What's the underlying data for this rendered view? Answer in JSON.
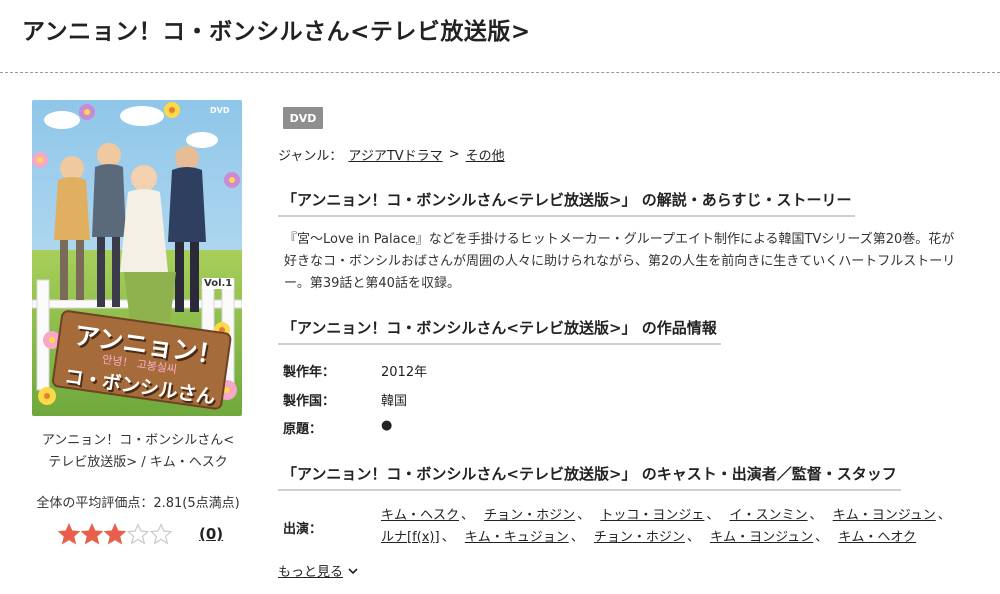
{
  "page": {
    "title": "アンニョン！コ・ボンシルさん<テレビ放送版>"
  },
  "cover": {
    "logo_line1": "アンニョン！",
    "logo_line2": "コ・ボンシルさん",
    "logo_sub": "안녕！ 고봉실씨",
    "vol": "Vol.1",
    "format_mark": "DVD"
  },
  "caption": {
    "line1": "アンニョン！コ・ボンシルさん<",
    "line2": "テレビ放送版> / キム・ヘスク"
  },
  "rating": {
    "label": "全体の平均評価点：2.81(5点満点)",
    "value": 2.81,
    "max": 5,
    "filled_stars": 3,
    "review_count": "(0)",
    "star_color": "#e8604c"
  },
  "badge": "DVD",
  "genre": {
    "label": "ジャンル：",
    "links": [
      "アジアTVドラマ",
      "その他"
    ],
    "separator": ">"
  },
  "synopsis": {
    "heading": "「アンニョン！コ・ボンシルさん<テレビ放送版>」 の解説・あらすじ・ストーリー",
    "text": "『宮〜Love in Palace』などを手掛けるヒットメーカー・グループエイト制作による韓国TVシリーズ第20巻。花が好きなコ・ボンシルおばさんが周囲の人々に助けられながら、第2の人生を前向きに生きていくハートフルストーリー。第39話と第40話を収録。"
  },
  "info": {
    "heading": "「アンニョン！コ・ボンシルさん<テレビ放送版>」 の作品情報",
    "rows": [
      {
        "label": "製作年：",
        "value": "2012年"
      },
      {
        "label": "製作国：",
        "value": "韓国"
      },
      {
        "label": "原題：",
        "value": "●"
      }
    ]
  },
  "cast": {
    "heading": "「アンニョン！コ・ボンシルさん<テレビ放送版>」 のキャスト・出演者／監督・スタッフ",
    "label": "出演：",
    "members": [
      "キム・ヘスク",
      "チョン・ホジン",
      "トッコ・ヨンジェ",
      "イ・スンミン",
      "キム・ヨンジュン",
      "ルナ[f(x)]",
      "キム・キュジョン",
      "チョン・ホジン",
      "キム・ヨンジュン",
      "キム・ヘオク"
    ],
    "separator": "、",
    "more": "もっと見る"
  }
}
